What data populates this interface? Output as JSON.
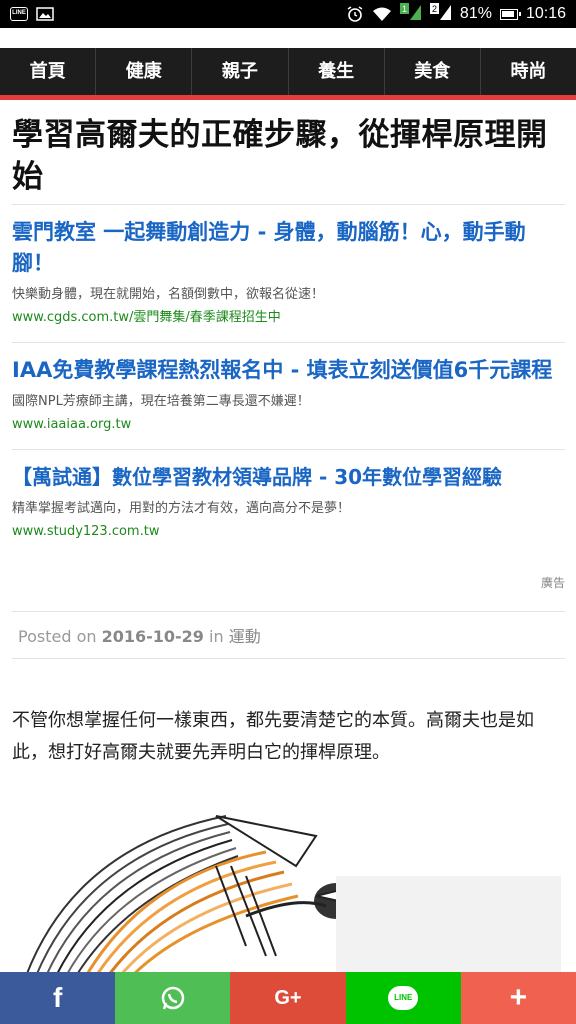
{
  "status_bar": {
    "app_icon_label": "LINE",
    "battery": "81%",
    "time": "10:16",
    "sim2": "2",
    "signal1": "1"
  },
  "nav": {
    "items": [
      "首頁",
      "健康",
      "親子",
      "養生",
      "美食",
      "時尚"
    ]
  },
  "article": {
    "title": "學習高爾夫的正確步驟，從揮桿原理開始",
    "posted_on_label": "Posted on",
    "date": "2016-10-29",
    "in_label": "in",
    "category": "運動",
    "body": "不管你想掌握任何一樣東西，都先要清楚它的本質。高爾夫也是如此，想打好高爾夫就要先弄明白它的揮桿原理。"
  },
  "ads": {
    "items": [
      {
        "title": "雲門教室 一起舞動創造力 - 身體，動腦筋！心，動手動腳！",
        "desc": "快樂動身體，現在就開始，名額倒數中，欲報名從速！",
        "url": "www.cgds.com.tw/雲門舞集/春季課程招生中"
      },
      {
        "title": "IAA免費教學課程熱烈報名中 - 填表立刻送價值6千元課程",
        "desc": "國際NPL芳療師主講，現在培養第二專長還不嫌遲！",
        "url": "www.iaaiaa.org.tw"
      },
      {
        "title": "【萬試通】數位學習教材領導品牌 - 30年數位學習經驗",
        "desc": "精準掌握考試邁向，用對的方法才有效，邁向高分不是夢！",
        "url": "www.study123.com.tw"
      }
    ],
    "label": "廣告"
  },
  "share": {
    "facebook": "f",
    "google_plus": "G+",
    "more": "+",
    "line": "LINE",
    "colors": {
      "facebook": "#3b5a9b",
      "whatsapp": "#4fbe55",
      "google_plus": "#dd4b39",
      "line": "#00c300",
      "more": "#f0624f"
    }
  },
  "colors": {
    "nav_accent": "#e33d3d",
    "ad_title": "#1a66c4",
    "ad_url": "#1c8a1c"
  }
}
